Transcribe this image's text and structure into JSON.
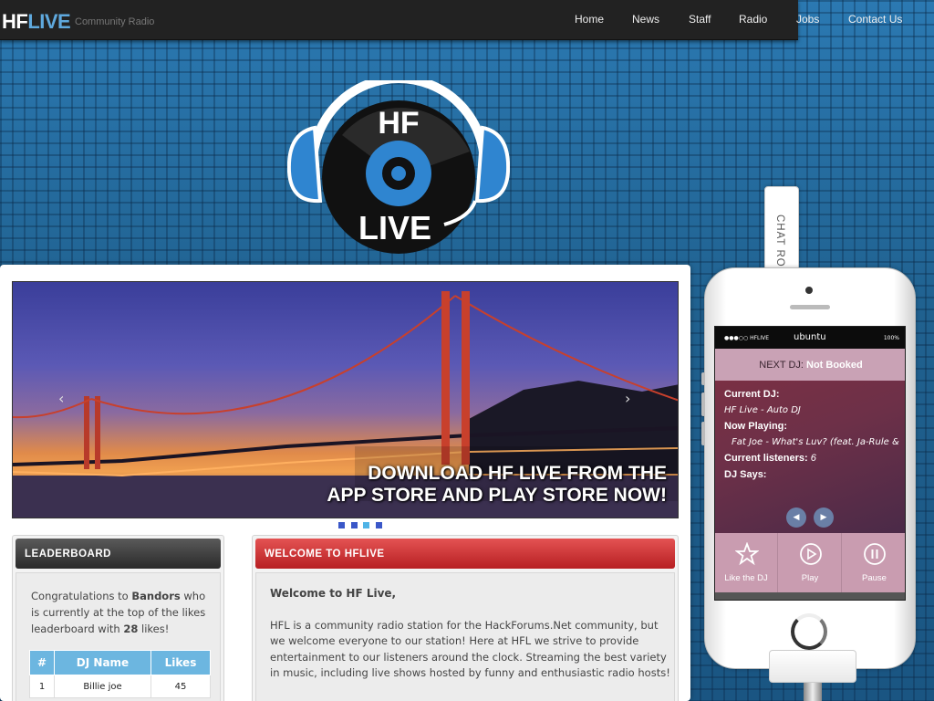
{
  "header": {
    "brand_hf": "HF",
    "brand_live": "LIVE",
    "tagline": "Community Radio",
    "nav": [
      "Home",
      "News",
      "Staff",
      "Radio",
      "Jobs",
      "Contact Us"
    ]
  },
  "logo": {
    "line1": "HF",
    "line2": "LIVE"
  },
  "slider": {
    "caption_line1": "DOWNLOAD HF LIVE FROM THE",
    "caption_line2": "APP STORE AND PLAY STORE NOW!",
    "prev": "‹",
    "next": "›",
    "slide_count": 4,
    "active_slide": 3
  },
  "leaderboard": {
    "title": "LEADERBOARD",
    "text_pre": "Congratulations to ",
    "winner": "Bandors",
    "text_mid": " who is currently at the top of the likes leaderboard with ",
    "likes": "28",
    "text_post": " likes!",
    "columns": [
      "#",
      "DJ Name",
      "Likes"
    ],
    "rows": [
      [
        "1",
        "Billie joe",
        "45"
      ]
    ]
  },
  "welcome": {
    "title": "WELCOME TO HFLIVE",
    "heading": "Welcome to HF Live,",
    "body": "HFL is a community radio station for the HackForums.Net community, but we welcome everyone to our station! Here at HFL we strive to provide entertainment to our listeners around the clock. Streaming the best variety in music, including live shows hosted by funny and enthusiastic radio hosts!"
  },
  "player": {
    "chat_tab": "CHAT ROOM",
    "status_left": "●●●○○ HFLIVE",
    "status_center": "ubuntu",
    "status_right": "100%",
    "next_dj_label": "NEXT DJ:",
    "next_dj_value": "Not Booked",
    "current_dj_label": "Current DJ:",
    "current_dj_value": "HF Live - Auto DJ",
    "now_playing_label": "Now Playing:",
    "now_playing_value": "Fat Joe - What's Luv? (feat. Ja-Rule &",
    "listeners_label": "Current listeners:",
    "listeners_value": "6",
    "dj_says_label": "DJ Says:",
    "actions": [
      "Like the DJ",
      "Play",
      "Pause"
    ]
  },
  "colors": {
    "accent_blue": "#5fa9de",
    "welcome_red": "#c8282b",
    "table_header": "#6cb6e0",
    "player_purple": "#c99cb0"
  }
}
